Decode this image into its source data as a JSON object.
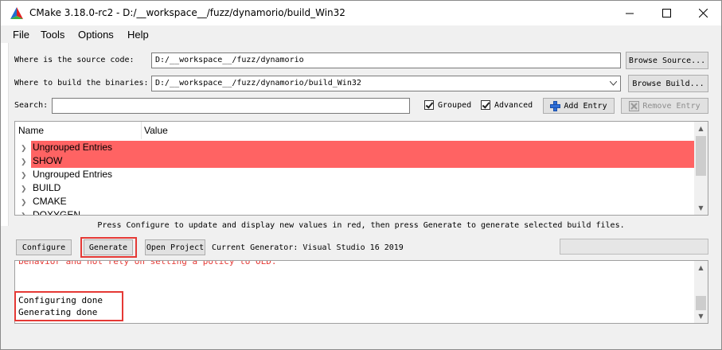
{
  "window": {
    "title": "CMake 3.18.0-rc2 - D:/__workspace__/fuzz/dynamorio/build_Win32",
    "controls": [
      "minimize-icon",
      "maximize-icon",
      "close-icon"
    ]
  },
  "menu": [
    {
      "label": "File",
      "mnemonic": "F"
    },
    {
      "label": "Tools",
      "mnemonic": "T"
    },
    {
      "label": "Options",
      "mnemonic": "O"
    },
    {
      "label": "Help",
      "mnemonic": "H"
    }
  ],
  "source": {
    "label": "Where is the source code:",
    "value": "D:/__workspace__/fuzz/dynamorio",
    "browse_label": "Browse Source..."
  },
  "build": {
    "label": "Where to build the binaries:",
    "value": "D:/__workspace__/fuzz/dynamorio/build_Win32",
    "browse_label": "Browse Build..."
  },
  "search": {
    "label": "Search:",
    "value": "",
    "grouped_label": "Grouped",
    "grouped_checked": true,
    "advanced_label": "Advanced",
    "advanced_checked": true,
    "add_entry_label": "Add Entry",
    "remove_entry_label": "Remove Entry"
  },
  "tree": {
    "columns": [
      "Name",
      "Value"
    ],
    "rows": [
      {
        "name": "Ungrouped Entries",
        "highlight": true
      },
      {
        "name": "SHOW",
        "highlight": true
      },
      {
        "name": "Ungrouped Entries",
        "highlight": false
      },
      {
        "name": "BUILD",
        "highlight": false
      },
      {
        "name": "CMAKE",
        "highlight": false
      },
      {
        "name": "DOXYGEN",
        "highlight": false
      }
    ],
    "highlight_color": "#ff6363"
  },
  "hint": "Press Configure to update and display new values in red, then press Generate to generate selected build files.",
  "actions": {
    "configure_label": "Configure",
    "generate_label": "Generate",
    "open_project_label": "Open Project",
    "generator_text": "Current Generator: Visual Studio 16 2019"
  },
  "output": {
    "lines": [
      {
        "text": "  behavior and not rely on setting a policy to OLD.",
        "color": "#e53935"
      },
      {
        "text": "",
        "color": "#000000"
      },
      {
        "text": "Configuring done",
        "color": "#000000"
      },
      {
        "text": "Generating done",
        "color": "#000000"
      }
    ]
  },
  "annotation_color": "#e53935"
}
